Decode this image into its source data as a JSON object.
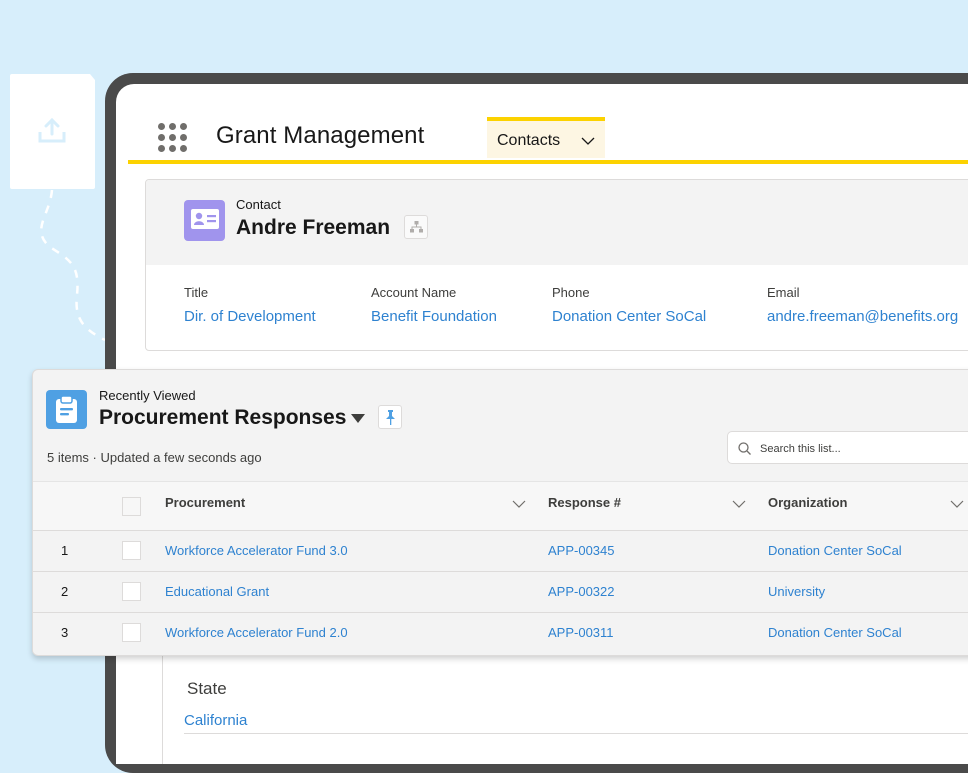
{
  "app": {
    "title": "Grant Management",
    "nav_tab": {
      "label": "Contacts"
    },
    "accent_color": "#fcd200"
  },
  "record": {
    "type_label": "Contact",
    "name": "Andre Freeman",
    "fields": [
      {
        "label": "Title",
        "value": "Dir. of Development"
      },
      {
        "label": "Account Name",
        "value": "Benefit Foundation"
      },
      {
        "label": "Phone",
        "value": "Donation Center SoCal"
      },
      {
        "label": "Email",
        "value": "andre.freeman@benefits.org"
      }
    ],
    "state": {
      "label": "State",
      "value": "California"
    }
  },
  "list_view": {
    "eyebrow": "Recently Viewed",
    "title": "Procurement Responses",
    "meta": "5 items · Updated a few seconds ago",
    "search": {
      "placeholder": "Search this list...",
      "value": ""
    },
    "columns": [
      "Procurement",
      "Response #",
      "Organization"
    ],
    "rows": [
      {
        "num": "1",
        "procurement": "Workforce Accelerator Fund 3.0",
        "response": "APP-00345",
        "organization": "Donation Center SoCal"
      },
      {
        "num": "2",
        "procurement": "Educational Grant",
        "response": "APP-00322",
        "organization": "University"
      },
      {
        "num": "3",
        "procurement": "Workforce Accelerator Fund 2.0",
        "response": "APP-00311",
        "organization": "Donation Center SoCal"
      }
    ]
  },
  "icons": {
    "upload": "upload-icon",
    "app_launcher": "waffle-icon",
    "contact": "contact-card-icon",
    "hierarchy": "hierarchy-icon",
    "list": "clipboard-icon",
    "pin": "pin-icon",
    "search": "search-icon"
  }
}
